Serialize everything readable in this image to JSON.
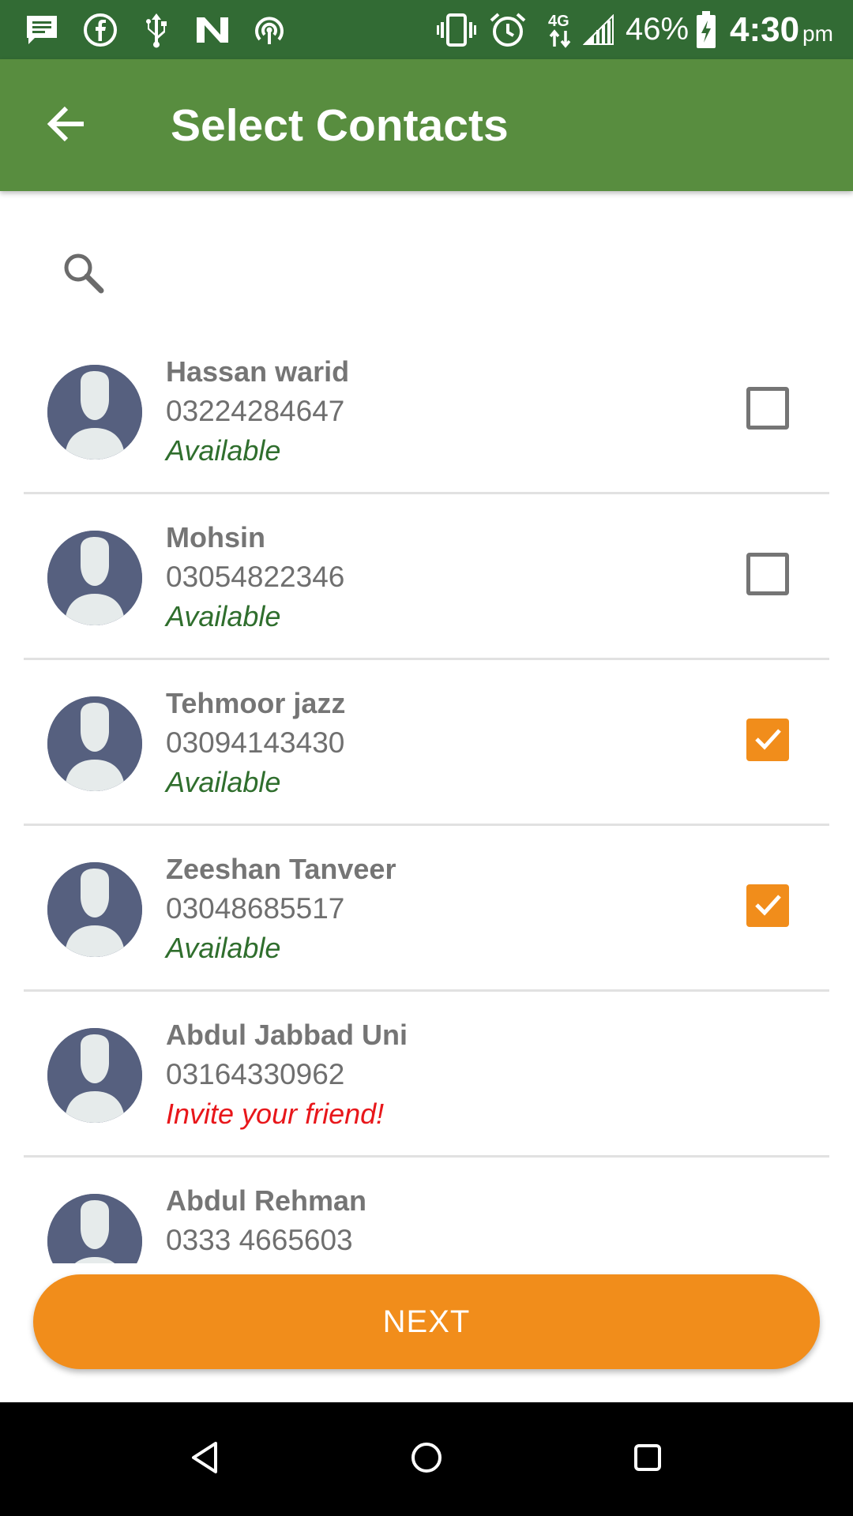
{
  "status_bar": {
    "battery": "46%",
    "time": "4:30",
    "ampm": "pm",
    "icons": [
      "message-icon",
      "facebook-icon",
      "usb-icon",
      "n-icon",
      "hotspot-icon",
      "vibrate-icon",
      "alarm-icon",
      "4g-icon",
      "signal-icon",
      "battery-icon"
    ]
  },
  "app_bar": {
    "title": "Select Contacts",
    "back_icon": "arrow-back-icon",
    "background": "#588d3f"
  },
  "search": {
    "placeholder": "",
    "value": "",
    "icon": "search-icon"
  },
  "contacts": [
    {
      "name": "Hassan warid",
      "phone": "03224284647",
      "status": "Available",
      "status_type": "available",
      "checked": false
    },
    {
      "name": "Mohsin",
      "phone": "03054822346",
      "status": "Available",
      "status_type": "available",
      "checked": false
    },
    {
      "name": "Tehmoor jazz",
      "phone": "03094143430",
      "status": "Available",
      "status_type": "available",
      "checked": true
    },
    {
      "name": "Zeeshan Tanveer",
      "phone": "03048685517",
      "status": "Available",
      "status_type": "available",
      "checked": true
    },
    {
      "name": "Abdul Jabbad Uni",
      "phone": "03164330962",
      "status": "Invite your friend!",
      "status_type": "invite",
      "checked": null
    },
    {
      "name": "Abdul Rehman",
      "phone": "0333 4665603",
      "status": "",
      "status_type": "",
      "checked": null
    }
  ],
  "next_button": {
    "label": "NEXT"
  },
  "colors": {
    "status_bar": "#326b34",
    "accent": "#f18d1b",
    "available": "#2f6e2d",
    "invite": "#e8171b",
    "avatar": "#56607f"
  },
  "nav_bar": {
    "icons": [
      "back-triangle-icon",
      "home-circle-icon",
      "recents-square-icon"
    ]
  }
}
